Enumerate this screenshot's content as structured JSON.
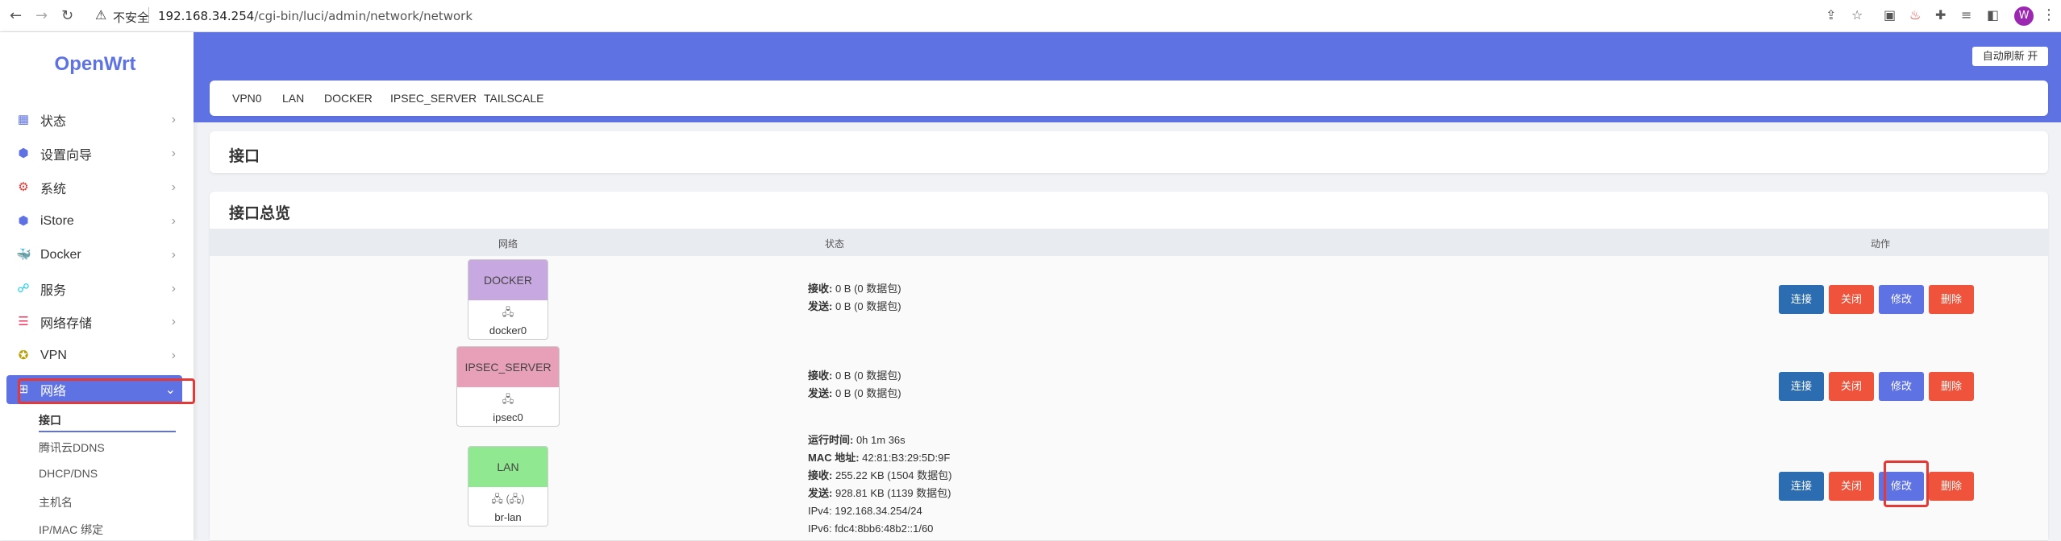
{
  "browser": {
    "insecure_label": "不安全",
    "url_host": "192.168.34.254",
    "url_path": "/cgi-bin/luci/admin/network/network",
    "profile_initial": "W"
  },
  "sidebar": {
    "logo": "OpenWrt",
    "items": [
      {
        "label": "状态",
        "icon": "dashboard-icon"
      },
      {
        "label": "设置向导",
        "icon": "cube-icon"
      },
      {
        "label": "系统",
        "icon": "gear-icon"
      },
      {
        "label": "iStore",
        "icon": "cube-icon"
      },
      {
        "label": "Docker",
        "icon": "docker-icon"
      },
      {
        "label": "服务",
        "icon": "services-icon"
      },
      {
        "label": "网络存储",
        "icon": "storage-icon"
      },
      {
        "label": "VPN",
        "icon": "vpn-icon"
      },
      {
        "label": "网络",
        "icon": "network-icon",
        "active": true
      }
    ],
    "subitems": [
      "接口",
      "腾讯云DDNS",
      "DHCP/DNS",
      "主机名",
      "IP/MAC 绑定"
    ]
  },
  "header": {
    "auto_refresh": "自动刷新 开"
  },
  "tabs": [
    "VPN0",
    "LAN",
    "DOCKER",
    "IPSEC_SERVER",
    "TAILSCALE"
  ],
  "page_title": "接口",
  "overview": {
    "title": "接口总览",
    "columns": {
      "network": "网络",
      "status": "状态",
      "actions": "动作"
    },
    "rows": [
      {
        "name": "DOCKER",
        "color": "#c8a8e0",
        "device_icon": "🖧",
        "device": "docker0",
        "status": [
          {
            "k": "接收:",
            "v": " 0 B (0 数据包)"
          },
          {
            "k": "发送:",
            "v": " 0 B (0 数据包)"
          }
        ]
      },
      {
        "name": "IPSEC_SERVER",
        "color": "#e8a0b8",
        "device_icon": "🖧",
        "device": "ipsec0",
        "status": [
          {
            "k": "接收:",
            "v": " 0 B (0 数据包)"
          },
          {
            "k": "发送:",
            "v": " 0 B (0 数据包)"
          }
        ]
      },
      {
        "name": "LAN",
        "color": "#90e890",
        "device_icon": "🖧 (🖧)",
        "device": "br-lan",
        "status": [
          {
            "k": "运行时间:",
            "v": " 0h 1m 36s"
          },
          {
            "k": "MAC 地址:",
            "v": " 42:81:B3:29:5D:9F"
          },
          {
            "k": "接收:",
            "v": " 255.22 KB (1504 数据包)"
          },
          {
            "k": "发送:",
            "v": " 928.81 KB (1139 数据包)"
          },
          {
            "k": "IPv4:",
            "v": " 192.168.34.254/24"
          },
          {
            "k": "IPv6:",
            "v": " fdc4:8bb6:48b2::1/60"
          }
        ]
      }
    ],
    "actions": {
      "connect": "连接",
      "close": "关闭",
      "edit": "修改",
      "delete": "删除"
    }
  },
  "colors": {
    "accent": "#5e72e4",
    "danger": "#f0533b",
    "connect": "#2b6db0",
    "highlight": "#e53935"
  }
}
